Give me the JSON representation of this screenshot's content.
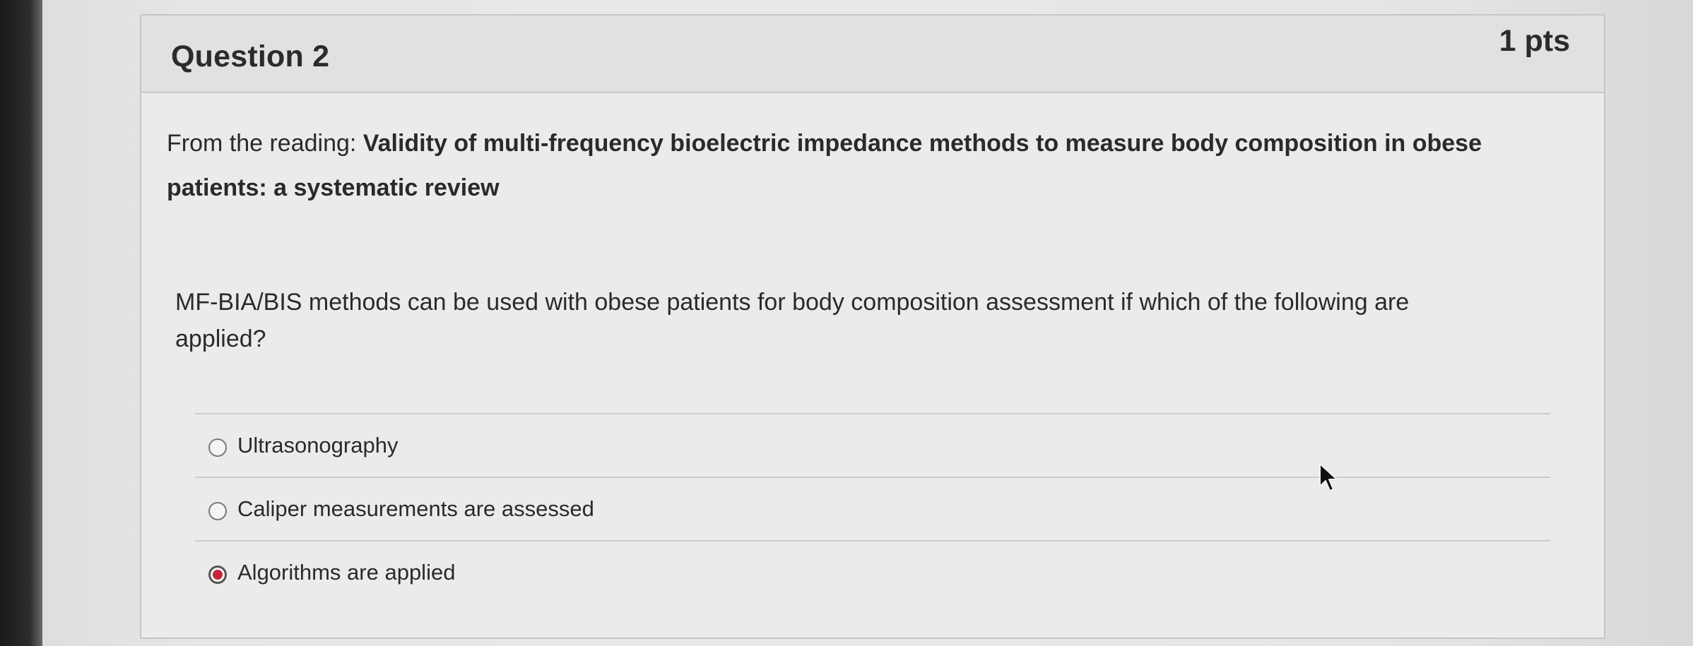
{
  "question": {
    "title": "Question 2",
    "points": "1 pts",
    "reading_prefix": "From the reading: ",
    "reading_title_line1": "Validity of multi-frequency bioelectric impedance methods to measure body composition in obese",
    "reading_title_line2": "patients: a systematic review",
    "prompt_line1": "MF-BIA/BIS methods can be used with obese patients for body composition assessment if which of the following are",
    "prompt_line2": "applied?"
  },
  "answers": [
    {
      "label": "Ultrasonography",
      "selected": false
    },
    {
      "label": "Caliper measurements are assessed",
      "selected": false
    },
    {
      "label": "Algorithms are applied",
      "selected": true
    }
  ],
  "colors": {
    "selected_radio": "#c7243a",
    "card_background": "#ebecea",
    "header_background": "#e1e2e0"
  },
  "icons": {
    "cursor": "mouse-pointer-icon"
  }
}
